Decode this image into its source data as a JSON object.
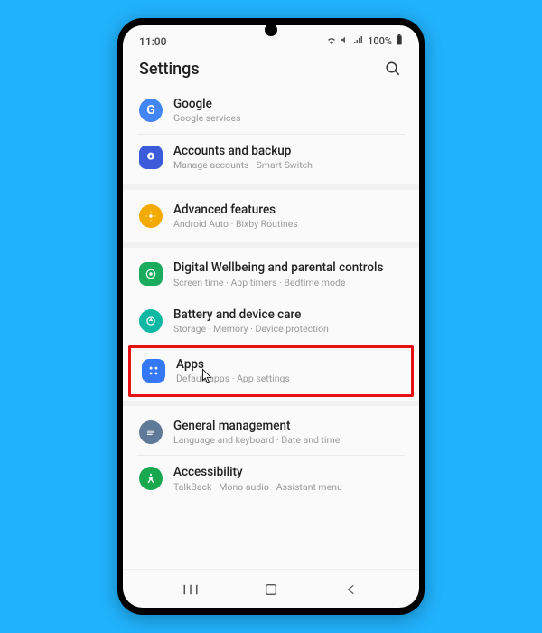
{
  "status": {
    "time": "11:00",
    "battery_pct": "100%"
  },
  "header": {
    "title": "Settings"
  },
  "rows": {
    "google": {
      "title": "Google",
      "sub": "Google services"
    },
    "accounts": {
      "title": "Accounts and backup",
      "sub": "Manage accounts · Smart Switch"
    },
    "advanced": {
      "title": "Advanced features",
      "sub": "Android Auto · Bixby Routines"
    },
    "wellbeing": {
      "title": "Digital Wellbeing and parental controls",
      "sub": "Screen time · App timers · Bedtime mode"
    },
    "battery": {
      "title": "Battery and device care",
      "sub": "Storage · Memory · Device protection"
    },
    "apps": {
      "title": "Apps",
      "sub": "Default apps · App settings"
    },
    "general": {
      "title": "General management",
      "sub": "Language and keyboard · Date and time"
    },
    "access": {
      "title": "Accessibility",
      "sub": "TalkBack · Mono audio · Assistant menu"
    }
  }
}
